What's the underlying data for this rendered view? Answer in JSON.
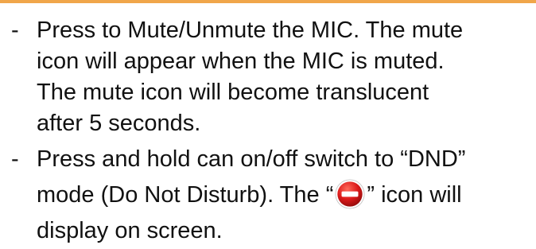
{
  "bullet_symbol": "-",
  "items": [
    {
      "lines": [
        "Press to Mute/Unmute the MIC. The mute",
        "icon will appear when the MIC is muted.",
        "The mute icon will become translucent",
        "after 5 seconds."
      ]
    },
    {
      "line1": "Press and hold can on/off switch to “DND”",
      "line2_before": "mode (Do Not Disturb). The “",
      "icon": "do-not-disturb-icon",
      "line2_after": "” icon will",
      "line3": "display on screen."
    }
  ],
  "colors": {
    "rule": "#f0a64a",
    "dnd_red": "#d8141c",
    "text": "#111111"
  }
}
